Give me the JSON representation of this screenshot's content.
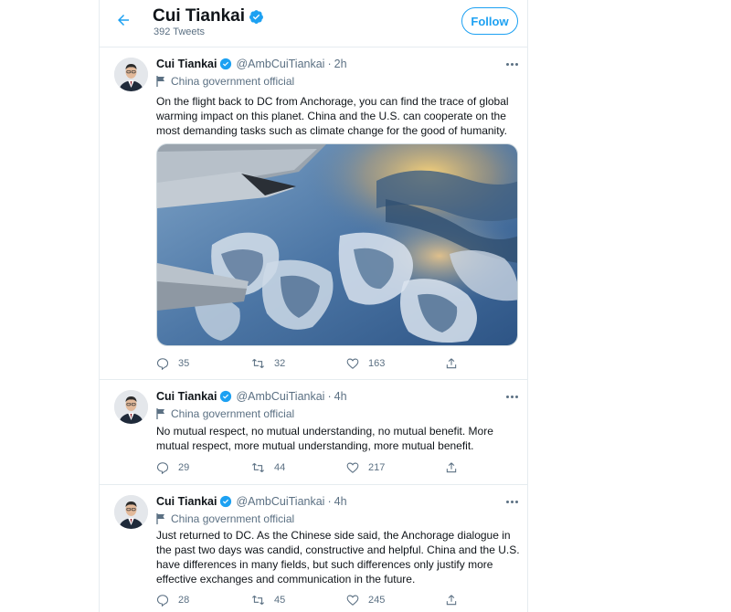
{
  "header": {
    "name": "Cui Tiankai",
    "tweet_count": "392 Tweets",
    "follow_label": "Follow"
  },
  "colors": {
    "accent": "#1da1f2",
    "verified": "#1da1f2",
    "secondary_text": "#5b7083"
  },
  "tweets": [
    {
      "name": "Cui Tiankai",
      "handle": "@AmbCuiTiankai",
      "separator": "·",
      "time": "2h",
      "label": "China government official",
      "text": "On the flight back to DC from Anchorage, you can find  the trace of global warming impact on this planet. China and the U.S. can cooperate on the most demanding tasks such as climate change for the good of humanity.",
      "replies": "35",
      "retweets": "32",
      "likes": "163"
    },
    {
      "name": "Cui Tiankai",
      "handle": "@AmbCuiTiankai",
      "separator": "·",
      "time": "4h",
      "label": "China government official",
      "text": "No mutual respect, no mutual understanding, no mutual benefit. More mutual respect, more mutual understanding, more mutual benefit.",
      "replies": "29",
      "retweets": "44",
      "likes": "217"
    },
    {
      "name": "Cui Tiankai",
      "handle": "@AmbCuiTiankai",
      "separator": "·",
      "time": "4h",
      "label": "China government official",
      "text": "Just returned to DC. As the Chinese side said, the Anchorage dialogue in the past two days was candid, constructive and helpful. China and the U.S. have differences in many fields, but such differences only justify more effective exchanges and communication in the future.",
      "replies": "28",
      "retweets": "45",
      "likes": "245"
    }
  ]
}
